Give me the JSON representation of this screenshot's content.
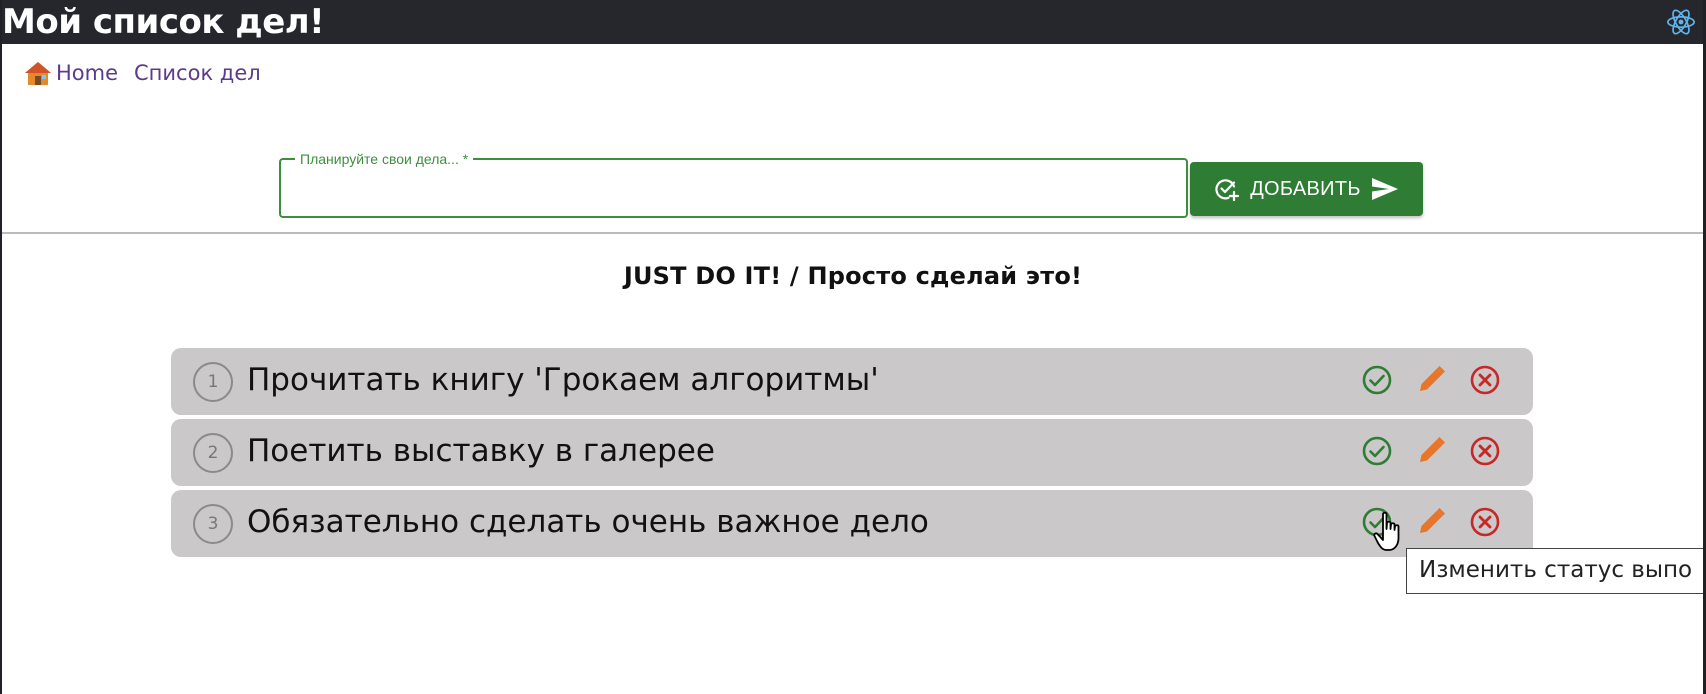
{
  "header": {
    "title": "Мой список дел!",
    "logo_icon": "react-atom-icon"
  },
  "nav": {
    "home_icon": "house-icon",
    "items": [
      {
        "label": "Home"
      },
      {
        "label": "Список дел"
      }
    ]
  },
  "form": {
    "input_label": "Планируйте свои дела... *",
    "input_value": "",
    "add_label": "ДОБАВИТЬ",
    "add_icon": "add-task-icon",
    "send_icon": "send-icon"
  },
  "motto": "JUST DO IT! / Просто сделай это!",
  "tasks": [
    {
      "number": "1",
      "text": "Прочитать книгу 'Грокаем алгоритмы'"
    },
    {
      "number": "2",
      "text": "Поетить выставку в галерее"
    },
    {
      "number": "3",
      "text": "Обязательно сделать очень важное дело"
    }
  ],
  "tooltip": "Изменить статус выпо",
  "colors": {
    "header_bg": "#25272d",
    "accent_green": "#2f7d34",
    "edit_orange": "#e8762a",
    "delete_red": "#c62828",
    "task_bg": "#cac8c9",
    "nav_link": "#5c3b8a"
  }
}
